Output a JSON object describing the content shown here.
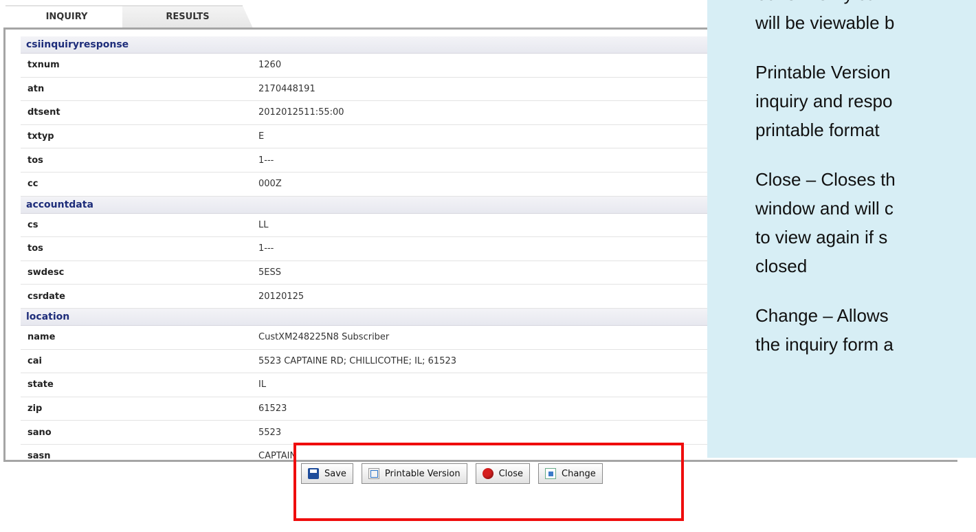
{
  "tabs": [
    {
      "label": "INQUIRY",
      "active": true
    },
    {
      "label": "RESULTS",
      "active": false
    }
  ],
  "table": {
    "rows": [
      {
        "type": "section",
        "label": "csiinquiryresponse"
      },
      {
        "type": "field",
        "key": "txnum",
        "value": "1260"
      },
      {
        "type": "field",
        "key": "atn",
        "value": "2170448191"
      },
      {
        "type": "field",
        "key": "dtsent",
        "value": "2012012511:55:00"
      },
      {
        "type": "field",
        "key": "txtyp",
        "value": "E"
      },
      {
        "type": "field",
        "key": "tos",
        "value": "1---"
      },
      {
        "type": "field",
        "key": "cc",
        "value": "000Z"
      },
      {
        "type": "section",
        "label": "accountdata"
      },
      {
        "type": "field",
        "key": "cs",
        "value": "LL"
      },
      {
        "type": "field",
        "key": "tos",
        "value": "1---"
      },
      {
        "type": "field",
        "key": "swdesc",
        "value": "5ESS"
      },
      {
        "type": "field",
        "key": "csrdate",
        "value": "20120125"
      },
      {
        "type": "section",
        "label": "location"
      },
      {
        "type": "field",
        "key": "name",
        "value": "CustXM248225N8 Subscriber"
      },
      {
        "type": "field",
        "key": "cai",
        "value": "5523 CAPTAINE RD; CHILLICOTHE; IL; 61523"
      },
      {
        "type": "field",
        "key": "state",
        "value": "IL"
      },
      {
        "type": "field",
        "key": "zip",
        "value": "61523"
      },
      {
        "type": "field",
        "key": "sano",
        "value": "5523"
      },
      {
        "type": "field",
        "key": "sasn",
        "value": "CAPTAIN"
      }
    ]
  },
  "buttons": {
    "save": "Save",
    "printable": "Printable Version",
    "close": "Close",
    "change": "Change"
  },
  "callout": {
    "bullets": [
      "Save – Only sav\nwill be viewable b",
      "Printable Version\ninquiry and respo\nprintable format",
      "Close – Closes th\nwindow and will c\nto view again if s\nclosed",
      "Change – Allows\nthe inquiry form a"
    ]
  },
  "colors": {
    "section_text": "#1e2d7a",
    "callout_bg": "#d7eef5",
    "bullet": "#e0301e",
    "highlight": "#ef0d0d"
  }
}
